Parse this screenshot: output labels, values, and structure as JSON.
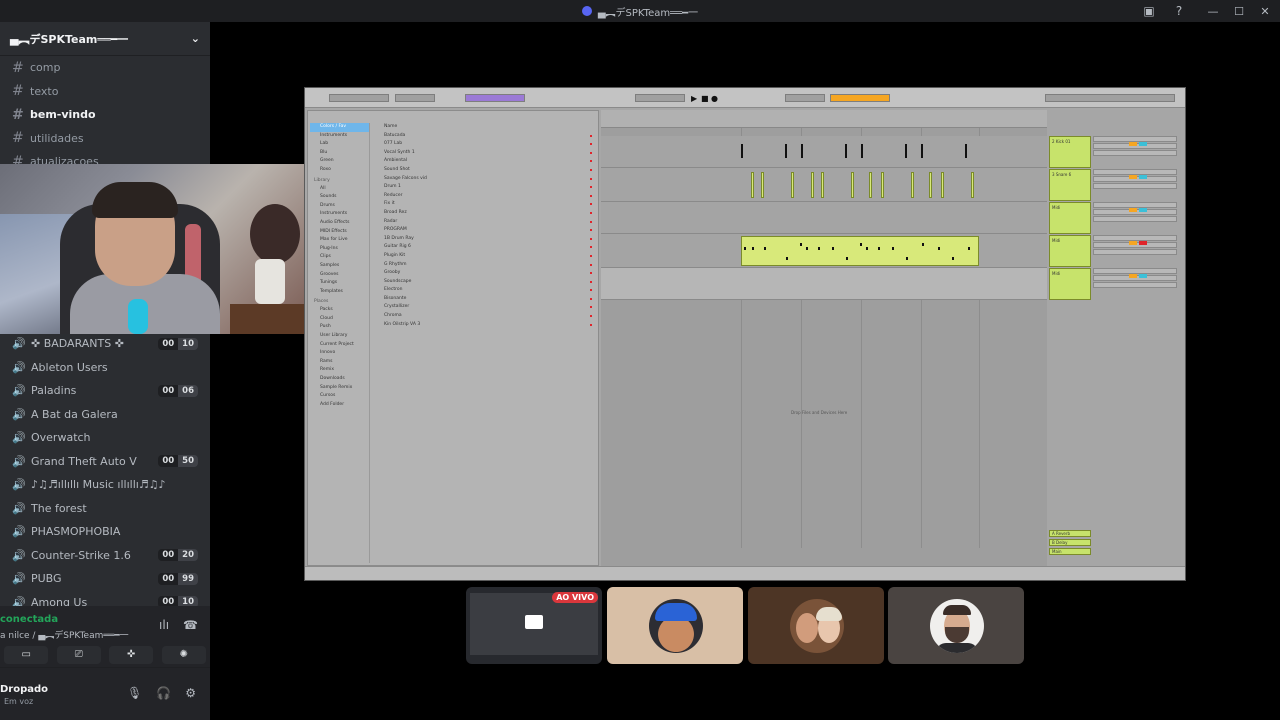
{
  "window": {
    "title": "▄︻デSPKTeam══━一",
    "controls": [
      "—",
      "☐",
      "✕"
    ]
  },
  "server": {
    "name": "▄︻デSPKTeam══━一"
  },
  "text_channels": [
    {
      "name": "comp"
    },
    {
      "name": "texto"
    },
    {
      "name": "bem-vindo"
    },
    {
      "name": "utilidades"
    },
    {
      "name": "atualizacoes"
    }
  ],
  "voice_channels": [
    {
      "name": "✜ BADARANTS ✜",
      "count": "00",
      "limit": "10"
    },
    {
      "name": "Ableton Users",
      "count": "",
      "limit": ""
    },
    {
      "name": "Paladins",
      "count": "00",
      "limit": "06"
    },
    {
      "name": "A Bat da Galera",
      "count": "",
      "limit": ""
    },
    {
      "name": "Overwatch",
      "count": "",
      "limit": ""
    },
    {
      "name": "Grand Theft Auto V",
      "count": "00",
      "limit": "50"
    },
    {
      "name": "♪♫♬ıllıllı Music ıllıllı♬♫♪",
      "count": "",
      "limit": ""
    },
    {
      "name": "The forest",
      "count": "",
      "limit": ""
    },
    {
      "name": "PHASMOPHOBIA",
      "count": "",
      "limit": ""
    },
    {
      "name": "Counter-Strike 1.6",
      "count": "00",
      "limit": "20"
    },
    {
      "name": "PUBG",
      "count": "00",
      "limit": "99"
    },
    {
      "name": "Among Us",
      "count": "00",
      "limit": "10"
    }
  ],
  "voice_panel": {
    "status": "conectada",
    "location": "a nilce / ▄︻デSPKTeam══━一"
  },
  "user_panel": {
    "name": "Dropado",
    "status": "Em voz"
  },
  "ableton": {
    "browser_categories": [
      "Colors / Fav",
      "Instruments",
      "Lab",
      "Blu",
      "Green",
      "Roxo"
    ],
    "library_header": "Library",
    "library_items": [
      "All",
      "Sounds",
      "Drums",
      "Instruments",
      "Audio Effects",
      "MIDI Effects",
      "Max for Live",
      "Plug-Ins",
      "Clips",
      "Samples",
      "Grooves",
      "Tunings",
      "Templates"
    ],
    "places_header": "Places",
    "places_items": [
      "Packs",
      "Cloud",
      "Push",
      "User Library",
      "Current Project",
      "Innovo",
      "Rams",
      "Remix",
      "Downloads",
      "Sample Remix",
      "Cursos",
      "Add Folder"
    ],
    "folder_header": "Name",
    "folder_items": [
      "Batucada",
      "077 Lab",
      "Vocal Synth 1",
      "Ambiental",
      "Sound Shot",
      "Savage Falcons vid",
      "Drum 1",
      "Reducer",
      "Fix it",
      "Broad Rez",
      "Radar",
      "PROGRAM",
      "1B Drum Ray",
      "Guitar Rig 6",
      "Plugin Kit",
      "G Rhythm",
      "Grooby",
      "Soundscape",
      "Electron",
      "Bisonante",
      "Crystallizer",
      "Chroma",
      "Kin Oilstrip VA 3"
    ],
    "empty_hint": "Drop Files and Devices Here",
    "tracks": [
      "2 Kick 01",
      "3 Snare 6",
      "Midi",
      "Midi",
      "Midi"
    ],
    "returns": [
      "A Reverb",
      "B Delay",
      "Main"
    ]
  },
  "tiles": {
    "live_label": "AO VIVO"
  }
}
